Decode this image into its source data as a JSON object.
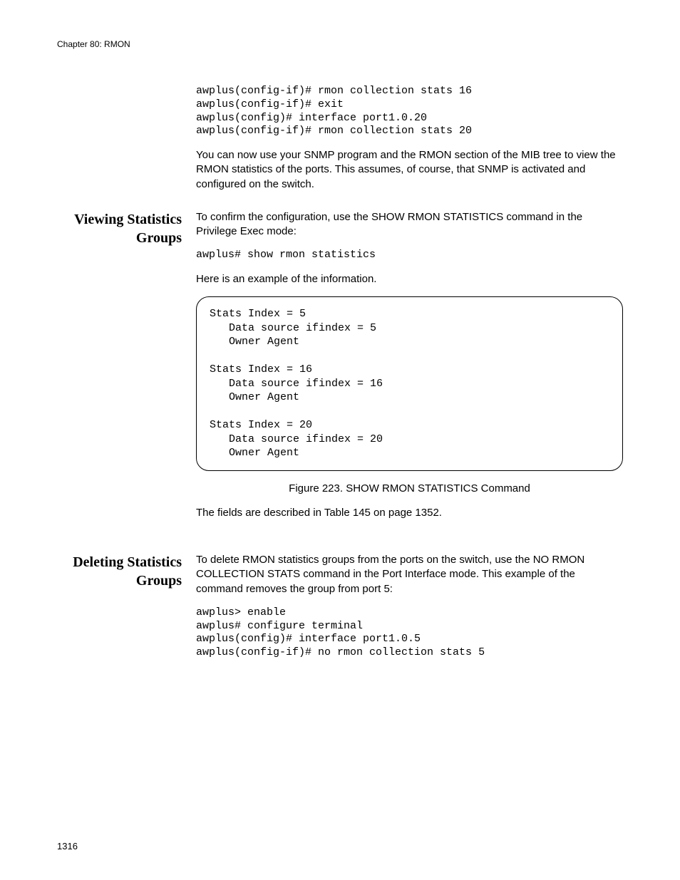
{
  "header": {
    "chapter": "Chapter 80: RMON"
  },
  "section1": {
    "code1": "awplus(config-if)# rmon collection stats 16\nawplus(config-if)# exit\nawplus(config)# interface port1.0.20\nawplus(config-if)# rmon collection stats 20",
    "para1": "You can now use your SNMP program and the RMON section of the MIB tree to view the RMON statistics of the ports. This assumes, of course, that SNMP is activated and configured on the switch."
  },
  "section2": {
    "heading": "Viewing Statistics Groups",
    "para1": "To confirm the configuration, use the SHOW RMON STATISTICS command in the Privilege Exec mode:",
    "code1": "awplus# show rmon statistics",
    "para2": "Here is an example of the information.",
    "output": "Stats Index = 5\n   Data source ifindex = 5\n   Owner Agent\n\nStats Index = 16\n   Data source ifindex = 16\n   Owner Agent\n\nStats Index = 20\n   Data source ifindex = 20\n   Owner Agent",
    "caption": "Figure 223. SHOW RMON STATISTICS Command",
    "para3": "The fields are described in Table 145 on page 1352."
  },
  "section3": {
    "heading": "Deleting Statistics Groups",
    "para1": "To delete RMON statistics groups from the ports on the switch, use the NO RMON COLLECTION STATS command in the Port Interface mode. This example of the command removes the group from port 5:",
    "code1": "awplus> enable\nawplus# configure terminal\nawplus(config)# interface port1.0.5\nawplus(config-if)# no rmon collection stats 5"
  },
  "footer": {
    "page": "1316"
  }
}
